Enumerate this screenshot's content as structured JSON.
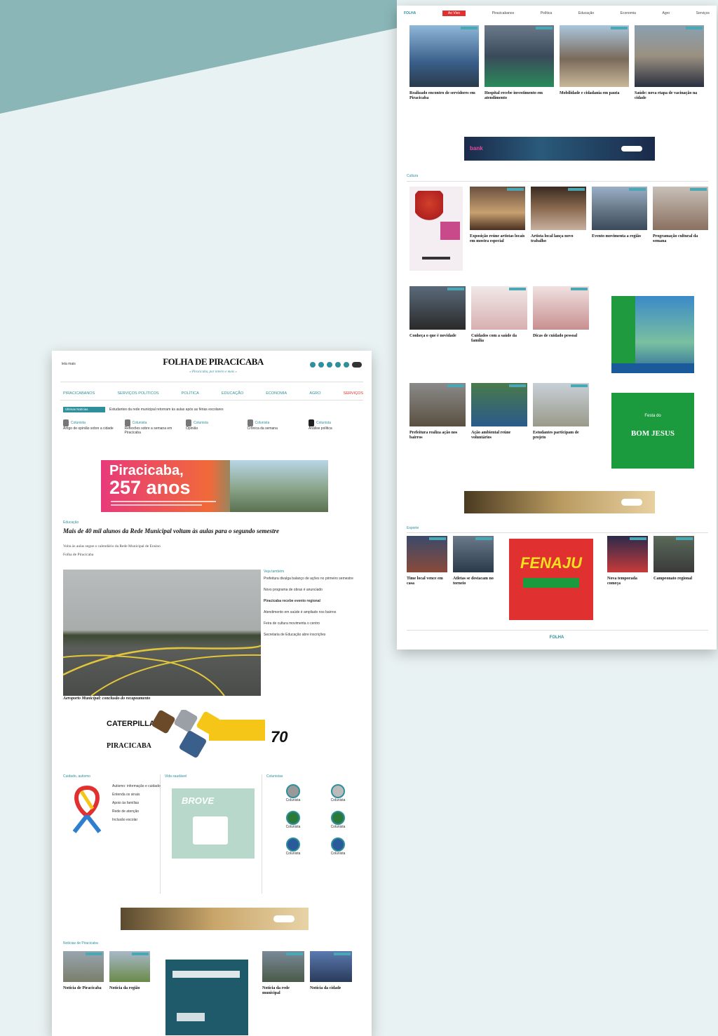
{
  "p1": {
    "header": {
      "left": "leia mais",
      "logo": "FOLHA DE PIRACICABA",
      "tagline": "« Piracicaba, por inteiro e mais »"
    },
    "nav": [
      "PIRACICABANOS",
      "SERVIÇOS POLÍTICOS",
      "POLÍTICA",
      "EDUCAÇÃO",
      "ECONOMIA",
      "AGRO",
      "SERVIÇOS"
    ],
    "ticker": {
      "label": "Últimas Notícias",
      "text": "Estudantes da rede municipal retornam às aulas após as férias escolares"
    },
    "columnists": [
      {
        "name": "Colunista",
        "text": "Artigo de opinião sobre a cidade"
      },
      {
        "name": "Colunista",
        "text": "Reflexões sobre a semana em Piracicaba"
      },
      {
        "name": "Colunista",
        "text": "Opinião"
      },
      {
        "name": "Colunista",
        "text": "Crônica da semana"
      },
      {
        "name": "Colunista",
        "text": "Análise política"
      }
    ],
    "banner_main": {
      "line1": "Piracicaba,",
      "line2": "257 anos"
    },
    "lead": {
      "section": "Educação",
      "title": "Mais de 40 mil alunos da Rede Municipal voltam às aulas para o segundo semestre",
      "sub": "Volta às aulas segue o calendário da Rede Municipal de Ensino",
      "byline": "Folha de Piracicaba",
      "caption": "Aeroporto Municipal: conclusão do recapeamento",
      "side_links": [
        "Prefeitura divulga balanço de ações no primeiro semestre",
        "Novo programa de obras é anunciado",
        "Piracicaba recebe evento regional",
        "Atendimento em saúde é ampliado nos bairros",
        "Feira de cultura movimenta o centro",
        "Secretaria de Educação abre inscrições"
      ]
    },
    "ad_caterpillar": {
      "brand": "CATERPILLAR",
      "city": "PIRACICABA",
      "years": "70"
    },
    "widgets": {
      "left_title": "Cuidado, autismo",
      "left_items": [
        "Autismo: informação e cuidado",
        "Entenda os sinais",
        "Apoio às famílias",
        "Rede de atenção",
        "Inclusão escolar"
      ],
      "mid_title": "Vida saudável",
      "mid_brand": "BROVE",
      "right_title": "Colunistas",
      "people": [
        "Colunista",
        "Colunista",
        "Colunista",
        "Colunista",
        "Colunista",
        "Colunista"
      ]
    },
    "bottom_title": "Notícias de Piracicaba",
    "bottom_items": [
      "Notícia de Piracicaba",
      "Notícia da região",
      "Notícia da rede municipal",
      "Notícia da cidade"
    ]
  },
  "p2": {
    "nav": [
      "Ao Vivo",
      "Piracicabanos",
      "Política",
      "Educação",
      "Economia",
      "Agro",
      "Serviços"
    ],
    "top_stories": [
      "Realizado encontro de servidores em Piracicaba",
      "Hospital recebe investimento em atendimento",
      "Mobilidade e cidadania em pauta",
      "Saúde: nova etapa de vacinação na cidade"
    ],
    "second_title": "Cultura",
    "second_stories": [
      "Exposição reúne artistas locais em mostra especial",
      "Artista local lança novo trabalho",
      "Evento movimenta a região",
      "Programação cultural da semana"
    ],
    "grid2": [
      "Conheça o que é novidade",
      "Cuidados com a saúde da família",
      "Dicas de cuidado pessoal"
    ],
    "grid3": [
      "Prefeitura realiza ação nos bairros",
      "Ação ambiental reúne voluntários",
      "Estudantes participam de projeto"
    ],
    "ad_green": {
      "line1": "Festa do",
      "line2": "BOM JESUS"
    },
    "sports_title": "Esporte",
    "sports": [
      "Time local vence em casa",
      "Atletas se destacam no torneio",
      "Nova temporada começa",
      "Campeonato regional"
    ],
    "sports_ad": "FENAJU",
    "footer_logo": "FOLHA"
  }
}
